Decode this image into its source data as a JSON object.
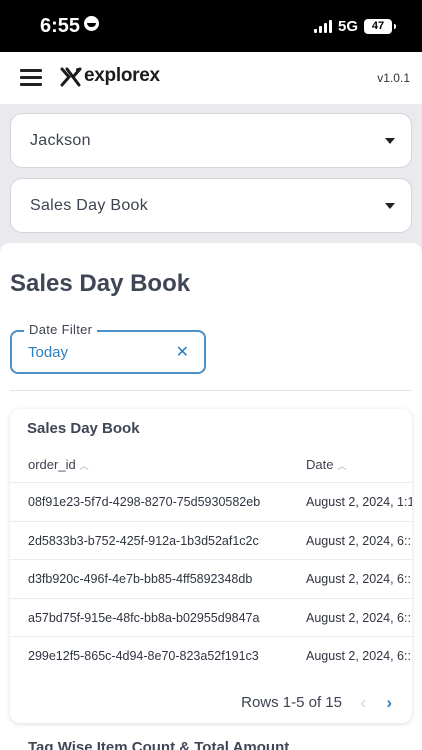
{
  "status": {
    "time": "6:55",
    "network": "5G",
    "battery": "47"
  },
  "header": {
    "brand": "explorex",
    "version": "v1.0.1"
  },
  "filters": {
    "store": "Jackson",
    "report": "Sales Day Book"
  },
  "page": {
    "title": "Sales Day Book"
  },
  "date_filter": {
    "label": "Date Filter",
    "value": "Today"
  },
  "table": {
    "title": "Sales Day Book",
    "columns": [
      "order_id",
      "Date"
    ],
    "rows": [
      {
        "order_id": "08f91e23-5f7d-4298-8270-75d5930582eb",
        "date": "August 2, 2024, 1:1"
      },
      {
        "order_id": "2d5833b3-b752-425f-912a-1b3d52af1c2c",
        "date": "August 2, 2024, 6::"
      },
      {
        "order_id": "d3fb920c-496f-4e7b-bb85-4ff5892348db",
        "date": "August 2, 2024, 6::"
      },
      {
        "order_id": "a57bd75f-915e-48fc-bb8a-b02955d9847a",
        "date": "August 2, 2024, 6::"
      },
      {
        "order_id": "299e12f5-865c-4d94-8e70-823a52f191c3",
        "date": "August 2, 2024, 6::"
      }
    ],
    "pagination": "Rows 1-5 of 15"
  },
  "next_section": {
    "title": "Tag Wise Item Count & Total Amount"
  },
  "colors": {
    "accent": "#2e7fc0",
    "background": "#e9e9ee"
  }
}
